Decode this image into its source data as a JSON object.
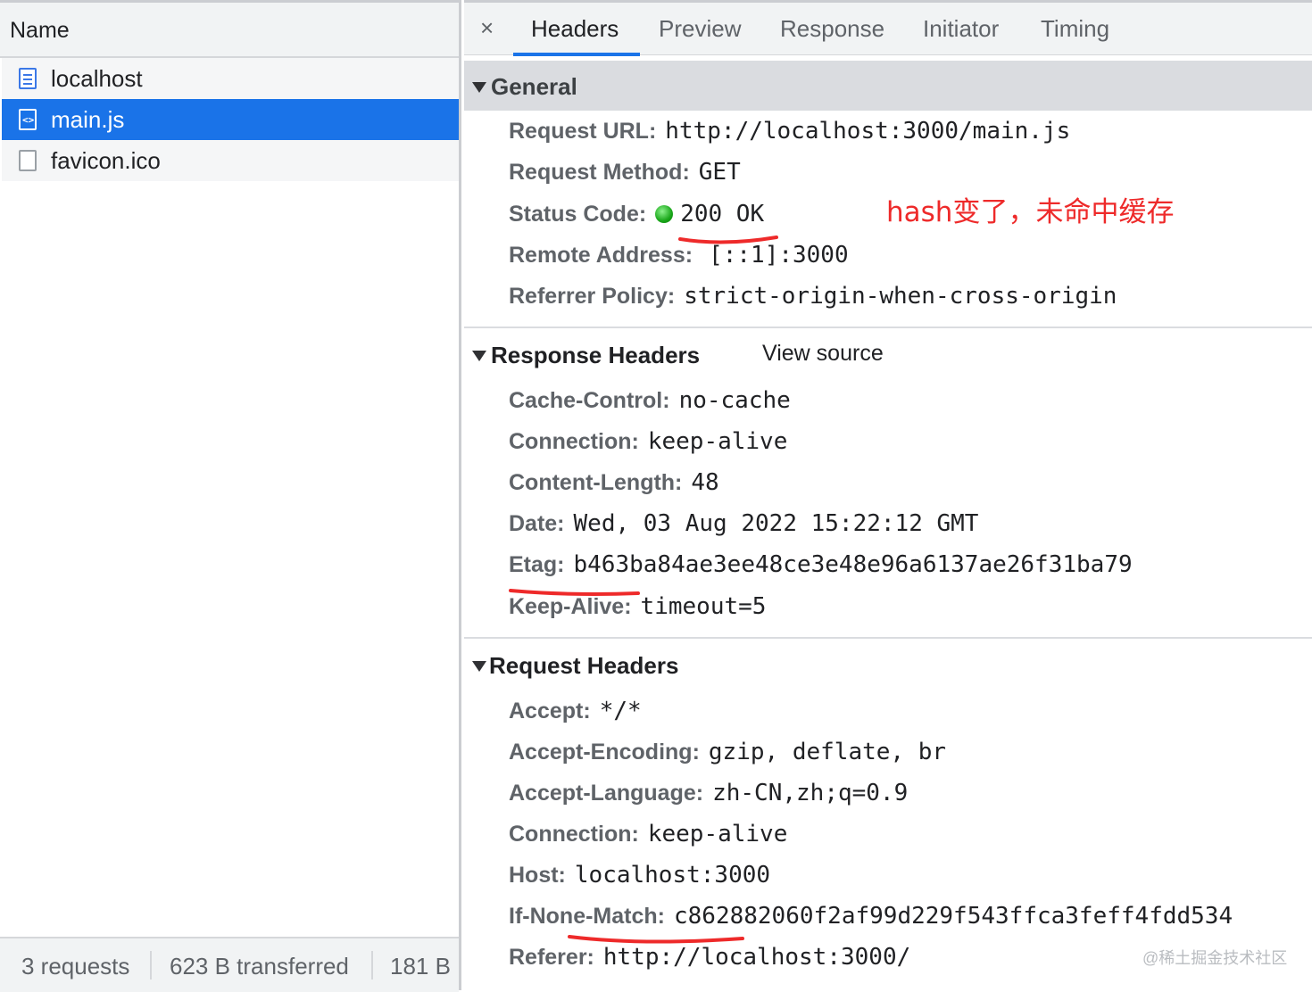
{
  "left": {
    "column_header": "Name",
    "requests": [
      {
        "name": "localhost",
        "type": "document",
        "selected": false
      },
      {
        "name": "main.js",
        "type": "script",
        "selected": true
      },
      {
        "name": "favicon.ico",
        "type": "other",
        "selected": false
      }
    ],
    "footer": {
      "requests": "3 requests",
      "transferred": "623 B transferred",
      "resources": "181 B"
    }
  },
  "tabs": {
    "close": "×",
    "items": [
      "Headers",
      "Preview",
      "Response",
      "Initiator",
      "Timing"
    ],
    "active": "Headers"
  },
  "general": {
    "title": "General",
    "request_url_key": "Request URL:",
    "request_url": "http://localhost:3000/main.js",
    "request_method_key": "Request Method:",
    "request_method": "GET",
    "status_code_key": "Status Code:",
    "status_code": "200 OK",
    "remote_address_key": "Remote Address:",
    "remote_address": "[::1]:3000",
    "referrer_policy_key": "Referrer Policy:",
    "referrer_policy": "strict-origin-when-cross-origin"
  },
  "response_headers": {
    "title": "Response Headers",
    "view_source": "View source",
    "items": [
      {
        "key": "Cache-Control:",
        "value": "no-cache"
      },
      {
        "key": "Connection:",
        "value": "keep-alive"
      },
      {
        "key": "Content-Length:",
        "value": "48"
      },
      {
        "key": "Date:",
        "value": "Wed, 03 Aug 2022 15:22:12 GMT"
      },
      {
        "key": "Etag:",
        "value": "b463ba84ae3ee48ce3e48e96a6137ae26f31ba79"
      },
      {
        "key": "Keep-Alive:",
        "value": "timeout=5"
      }
    ]
  },
  "request_headers": {
    "title": "Request Headers",
    "items": [
      {
        "key": "Accept:",
        "value": "*/*"
      },
      {
        "key": "Accept-Encoding:",
        "value": "gzip, deflate, br"
      },
      {
        "key": "Accept-Language:",
        "value": "zh-CN,zh;q=0.9"
      },
      {
        "key": "Connection:",
        "value": "keep-alive"
      },
      {
        "key": "Host:",
        "value": "localhost:3000"
      },
      {
        "key": "If-None-Match:",
        "value": "c862882060f2af99d229f543ffca3feff4fdd534"
      },
      {
        "key": "Referer:",
        "value": "http://localhost:3000/"
      }
    ]
  },
  "annotation": "hash变了，未命中缓存",
  "watermark": "@稀土掘金技术社区",
  "colors": {
    "accent": "#1a73e8",
    "annotation_red": "#ee2a2a",
    "status_green": "#19a619"
  },
  "icons": {
    "document": "document-icon",
    "script": "script-file-icon",
    "other": "file-icon",
    "close": "close-icon",
    "expand": "triangle-down-icon",
    "status": "status-green-dot-icon"
  }
}
